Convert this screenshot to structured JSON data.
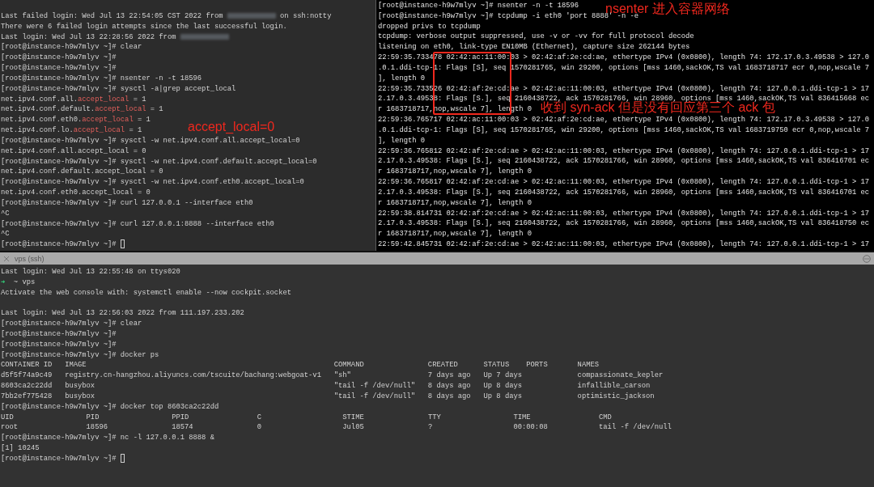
{
  "top_left": {
    "lines": [
      [
        "Last failed login: Wed Jul 13 22:54:05 CST 2022 from ",
        {
          "kind": "redacted"
        },
        " on ssh:notty"
      ],
      "There were 6 failed login attempts since the last successful login.",
      [
        "Last login: Wed Jul 13 22:28:56 2022 from ",
        {
          "kind": "redacted"
        }
      ],
      "[root@instance-h9w7mlyv ~]# clear",
      "[root@instance-h9w7mlyv ~]#",
      "[root@instance-h9w7mlyv ~]#",
      "[root@instance-h9w7mlyv ~]# nsenter -n -t 18596",
      "[root@instance-h9w7mlyv ~]# sysctl -a|grep accept_local",
      [
        "net.ipv4.conf.all.",
        {
          "kind": "red",
          "text": "accept_local"
        },
        " = 1"
      ],
      [
        "net.ipv4.conf.default.",
        {
          "kind": "red",
          "text": "accept_local"
        },
        " = 1"
      ],
      [
        "net.ipv4.conf.eth0.",
        {
          "kind": "red",
          "text": "accept_local"
        },
        " = 1"
      ],
      [
        "net.ipv4.conf.lo.",
        {
          "kind": "red",
          "text": "accept_local"
        },
        " = 1"
      ],
      "[root@instance-h9w7mlyv ~]# sysctl -w net.ipv4.conf.all.accept_local=0",
      "net.ipv4.conf.all.accept_local = 0",
      "[root@instance-h9w7mlyv ~]# sysctl -w net.ipv4.conf.default.accept_local=0",
      "net.ipv4.conf.default.accept_local = 0",
      "[root@instance-h9w7mlyv ~]# sysctl -w net.ipv4.conf.eth0.accept_local=0",
      "net.ipv4.conf.eth0.accept_local = 0",
      "[root@instance-h9w7mlyv ~]# curl 127.0.0.1 --interface eth0",
      "^C",
      "[root@instance-h9w7mlyv ~]# curl 127.0.0.1:8888 --interface eth0",
      "^C",
      [
        "[root@instance-h9w7mlyv ~]# ",
        {
          "kind": "cursor"
        }
      ]
    ]
  },
  "top_right": {
    "lines": [
      "[root@instance-h9w7mlyv ~]# nsenter -n -t 18596",
      "[root@instance-h9w7mlyv ~]# tcpdump -i eth0 'port 8888' -n -e",
      "dropped privs to tcpdump",
      "tcpdump: verbose output suppressed, use -v or -vv for full protocol decode",
      "listening on eth0, link-type EN10MB (Ethernet), capture size 262144 bytes",
      "22:59:35.733478 02:42:ac:11:00:03 > 02:42:af:2e:cd:ae, ethertype IPv4 (0x0800), length 74: 172.17.0.3.49538 > 127.0",
      ".0.1.ddi-tcp-1: Flags [S], seq 1570281765, win 29200, options [mss 1460,sackOK,TS val 1683718717 ecr 0,nop,wscale 7",
      "], length 0",
      "22:59:35.733526 02:42:af:2e:cd:ae > 02:42:ac:11:00:03, ethertype IPv4 (0x0800), length 74: 127.0.0.1.ddi-tcp-1 > 17",
      "2.17.0.3.49538: Flags [S.], seq 2160438722, ack 1570281766, win 28960, options [mss 1460,sackOK,TS val 836415668 ec",
      "r 1683718717,nop,wscale 7], length 0",
      "22:59:36.765717 02:42:ac:11:00:03 > 02:42:af:2e:cd:ae, ethertype IPv4 (0x0800), length 74: 172.17.0.3.49538 > 127.0",
      ".0.1.ddi-tcp-1: Flags [S], seq 1570281765, win 29200, options [mss 1460,sackOK,TS val 1683719750 ecr 0,nop,wscale 7",
      "], length 0",
      "22:59:36.765812 02:42:af:2e:cd:ae > 02:42:ac:11:00:03, ethertype IPv4 (0x0800), length 74: 127.0.0.1.ddi-tcp-1 > 17",
      "2.17.0.3.49538: Flags [S.], seq 2160438722, ack 1570281766, win 28960, options [mss 1460,sackOK,TS val 836416701 ec",
      "r 1683718717,nop,wscale 7], length 0",
      "22:59:36.765817 02:42:af:2e:cd:ae > 02:42:ac:11:00:03, ethertype IPv4 (0x0800), length 74: 127.0.0.1.ddi-tcp-1 > 17",
      "2.17.0.3.49538: Flags [S.], seq 2160438722, ack 1570281766, win 28960, options [mss 1460,sackOK,TS val 836416701 ec",
      "r 1683718717,nop,wscale 7], length 0",
      "22:59:38.814731 02:42:af:2e:cd:ae > 02:42:ac:11:00:03, ethertype IPv4 (0x0800), length 74: 127.0.0.1.ddi-tcp-1 > 17",
      "2.17.0.3.49538: Flags [S.], seq 2160438722, ack 1570281766, win 28960, options [mss 1460,sackOK,TS val 836418750 ec",
      "r 1683718717,nop,wscale 7], length 0",
      "22:59:42.845731 02:42:af:2e:cd:ae > 02:42:ac:11:00:03, ethertype IPv4 (0x0800), length 74: 127.0.0.1.ddi-tcp-1 > 17"
    ]
  },
  "annotations": [
    {
      "text": "nsenter 进入容器网络"
    },
    {
      "text": "accept_local=0"
    },
    {
      "text": "收到 syn-ack 但是没有回应第三个 ack 包"
    }
  ],
  "bottom": {
    "tab": {
      "title": "vps (ssh)"
    },
    "lines_1": [
      "Last login: Wed Jul 13 22:55:48 on ttys020",
      [
        {
          "kind": "green",
          "text": "➜"
        },
        "  ~ vps"
      ],
      "Activate the web console with: systemctl enable --now cockpit.socket"
    ],
    "lines_2": [
      "Last login: Wed Jul 13 22:56:03 2022 from 111.197.233.202",
      "[root@instance-h9w7mlyv ~]# clear",
      "[root@instance-h9w7mlyv ~]#",
      "[root@instance-h9w7mlyv ~]#",
      "[root@instance-h9w7mlyv ~]# docker ps"
    ],
    "docker_ps": {
      "columns": [
        "CONTAINER ID",
        "IMAGE",
        "COMMAND",
        "CREATED",
        "STATUS",
        "PORTS",
        "NAMES"
      ],
      "rows": [
        [
          "d5f5f74a9c49",
          "registry.cn-hangzhou.aliyuncs.com/tscuite/bachang:webgoat-v1",
          "\"sh\"",
          "7 days ago",
          "Up 7 days",
          null,
          "compassionate_kepler"
        ],
        [
          "8603ca2c22dd",
          "busybox",
          "\"tail -f /dev/null\"",
          "8 days ago",
          "Up 8 days",
          null,
          "infallible_carson"
        ],
        [
          "7bb2ef775428",
          "busybox",
          "\"tail -f /dev/null\"",
          "8 days ago",
          "Up 8 days",
          null,
          "optimistic_jackson"
        ]
      ]
    },
    "lines_3": [
      "[root@instance-h9w7mlyv ~]# docker top 8603ca2c22dd"
    ],
    "docker_top": {
      "columns": [
        "UID",
        "PID",
        "PPID",
        "C",
        "STIME",
        "TTY",
        "TIME",
        "CMD"
      ],
      "rows": [
        [
          "root",
          "18596",
          "18574",
          "0",
          "Jul05",
          "?",
          "00:00:08",
          "tail -f /dev/null"
        ]
      ]
    },
    "lines_4": [
      "[root@instance-h9w7mlyv ~]# nc -l 127.0.0.1 8888 &",
      "[1] 10245",
      [
        "[root@instance-h9w7mlyv ~]# ",
        {
          "kind": "cursor"
        }
      ]
    ]
  }
}
